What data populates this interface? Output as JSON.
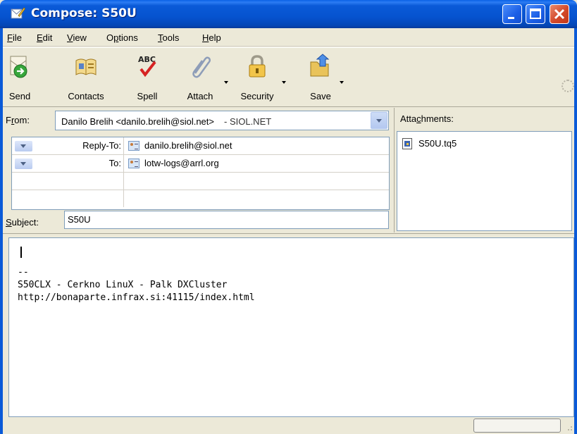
{
  "window": {
    "title": "Compose: S50U"
  },
  "menu": {
    "items": [
      {
        "label": "File",
        "accel": "F",
        "rest": "ile"
      },
      {
        "label": "Edit",
        "accel": "E",
        "rest": "dit"
      },
      {
        "label": "View",
        "accel": "V",
        "rest": "iew"
      },
      {
        "label": "Options",
        "accel": "p",
        "prefix": "O",
        "rest": "tions"
      },
      {
        "label": "Tools",
        "accel": "T",
        "rest": "ools"
      },
      {
        "label": "Help",
        "accel": "H",
        "rest": "elp"
      }
    ]
  },
  "toolbar": {
    "send": "Send",
    "contacts": "Contacts",
    "spell": "Spell",
    "attach": "Attach",
    "security": "Security",
    "save": "Save"
  },
  "from": {
    "label_accel": "r",
    "label_pre": "F",
    "label_post": "om:",
    "value": "Danilo Brelih <danilo.brelih@siol.net>",
    "account": "- SIOL.NET"
  },
  "recipients": [
    {
      "type": "Reply-To:",
      "address": "danilo.brelih@siol.net"
    },
    {
      "type": "To:",
      "address": "lotw-logs@arrl.org"
    }
  ],
  "subject": {
    "label_accel": "S",
    "label_post": "ubject:",
    "value": "S50U"
  },
  "attachments": {
    "label_pre": "Atta",
    "label_accel": "c",
    "label_post": "hments:",
    "files": [
      "S50U.tq5"
    ]
  },
  "body": {
    "signature_sep": "--",
    "signature_line1": "S50CLX - Cerkno LinuX - Palk DXCluster",
    "signature_line2": "http://bonaparte.infrax.si:41115/index.html"
  },
  "colors": {
    "titlebar": "#0a5ad8",
    "close": "#d3492a"
  }
}
